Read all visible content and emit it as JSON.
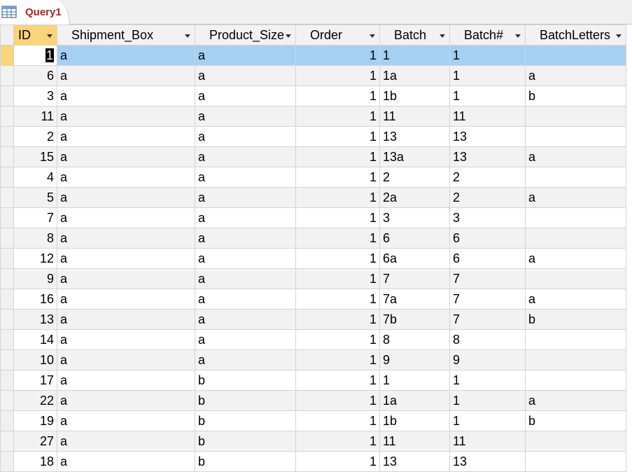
{
  "tab": {
    "label": "Query1",
    "icon": "query-table-icon"
  },
  "columns": [
    "ID",
    "Shipment_Box",
    "Product_Size",
    "Order",
    "Batch",
    "Batch#",
    "BatchLetters"
  ],
  "rows": [
    [
      "1",
      "a",
      "a",
      "1",
      "1",
      "1",
      ""
    ],
    [
      "6",
      "a",
      "a",
      "1",
      "1a",
      "1",
      "a"
    ],
    [
      "3",
      "a",
      "a",
      "1",
      "1b",
      "1",
      "b"
    ],
    [
      "11",
      "a",
      "a",
      "1",
      "11",
      "11",
      ""
    ],
    [
      "2",
      "a",
      "a",
      "1",
      "13",
      "13",
      ""
    ],
    [
      "15",
      "a",
      "a",
      "1",
      "13a",
      "13",
      "a"
    ],
    [
      "4",
      "a",
      "a",
      "1",
      "2",
      "2",
      ""
    ],
    [
      "5",
      "a",
      "a",
      "1",
      "2a",
      "2",
      "a"
    ],
    [
      "7",
      "a",
      "a",
      "1",
      "3",
      "3",
      ""
    ],
    [
      "8",
      "a",
      "a",
      "1",
      "6",
      "6",
      ""
    ],
    [
      "12",
      "a",
      "a",
      "1",
      "6a",
      "6",
      "a"
    ],
    [
      "9",
      "a",
      "a",
      "1",
      "7",
      "7",
      ""
    ],
    [
      "16",
      "a",
      "a",
      "1",
      "7a",
      "7",
      "a"
    ],
    [
      "13",
      "a",
      "a",
      "1",
      "7b",
      "7",
      "b"
    ],
    [
      "14",
      "a",
      "a",
      "1",
      "8",
      "8",
      ""
    ],
    [
      "10",
      "a",
      "a",
      "1",
      "9",
      "9",
      ""
    ],
    [
      "17",
      "a",
      "b",
      "1",
      "1",
      "1",
      ""
    ],
    [
      "22",
      "a",
      "b",
      "1",
      "1a",
      "1",
      "a"
    ],
    [
      "19",
      "a",
      "b",
      "1",
      "1b",
      "1",
      "b"
    ],
    [
      "27",
      "a",
      "b",
      "1",
      "11",
      "11",
      ""
    ],
    [
      "18",
      "a",
      "b",
      "1",
      "13",
      "13",
      ""
    ]
  ],
  "current_row": 0,
  "active_column": 0,
  "colors": {
    "tab_label": "#a4262c",
    "active_header": "#f9d478",
    "selected_row": "#a6d0f2"
  }
}
